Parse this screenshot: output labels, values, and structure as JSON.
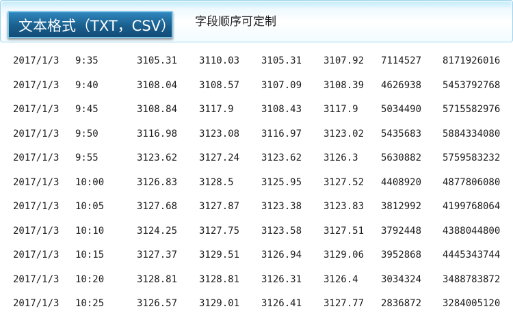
{
  "header": {
    "title": "文本格式（TXT，CSV）",
    "subtitle": "字段顺序可定制"
  },
  "rows": [
    [
      "2017/1/3",
      "9:35",
      "3105.31",
      "3110.03",
      "3105.31",
      "3107.92",
      "7114527",
      "8171926016"
    ],
    [
      "2017/1/3",
      "9:40",
      "3108.04",
      "3108.57",
      "3107.09",
      "3108.39",
      "4626938",
      "5453792768"
    ],
    [
      "2017/1/3",
      "9:45",
      "3108.84",
      "3117.9",
      "3108.43",
      "3117.9",
      "5034490",
      "5715582976"
    ],
    [
      "2017/1/3",
      "9:50",
      "3116.98",
      "3123.08",
      "3116.97",
      "3123.02",
      "5435683",
      "5884334080"
    ],
    [
      "2017/1/3",
      "9:55",
      "3123.62",
      "3127.24",
      "3123.62",
      "3126.3",
      "5630882",
      "5759583232"
    ],
    [
      "2017/1/3",
      "10:00",
      "3126.83",
      "3128.5",
      "3125.95",
      "3127.52",
      "4408920",
      "4877806080"
    ],
    [
      "2017/1/3",
      "10:05",
      "3127.68",
      "3127.87",
      "3123.38",
      "3123.83",
      "3812992",
      "4199768064"
    ],
    [
      "2017/1/3",
      "10:10",
      "3124.25",
      "3127.75",
      "3123.58",
      "3127.51",
      "3792448",
      "4388044800"
    ],
    [
      "2017/1/3",
      "10:15",
      "3127.37",
      "3129.51",
      "3126.94",
      "3129.06",
      "3952868",
      "4445343744"
    ],
    [
      "2017/1/3",
      "10:20",
      "3128.81",
      "3128.81",
      "3126.31",
      "3126.4",
      "3034324",
      "3488783872"
    ],
    [
      "2017/1/3",
      "10:25",
      "3126.57",
      "3129.01",
      "3126.41",
      "3127.77",
      "2836872",
      "3284005120"
    ]
  ]
}
